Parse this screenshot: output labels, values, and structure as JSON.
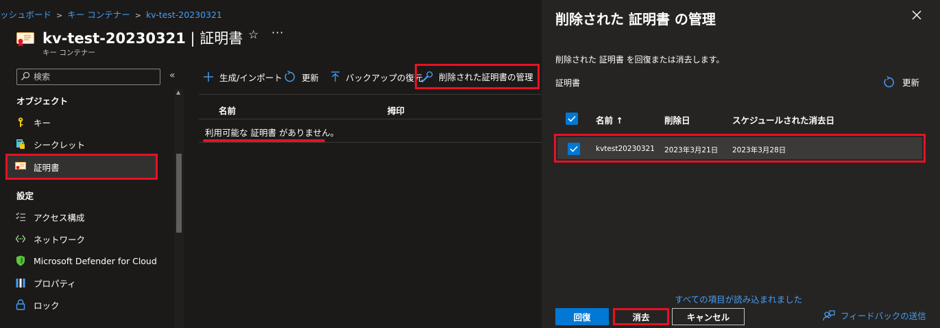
{
  "breadcrumb": {
    "items": [
      "ッシュボード",
      "キー コンテナー",
      "kv-test-20230321"
    ]
  },
  "header": {
    "title": "kv-test-20230321",
    "title_suffix": " | 証明書",
    "subtitle": "キー コンテナー",
    "star_icon": "star-icon",
    "more_label": "···"
  },
  "sidebar": {
    "search_placeholder": "検索",
    "collapse_label": "«",
    "sections": [
      {
        "heading": "オブジェクト",
        "items": [
          {
            "label": "キー",
            "icon": "key-icon"
          },
          {
            "label": "シークレット",
            "icon": "secret-icon"
          },
          {
            "label": "証明書",
            "icon": "certificate-icon",
            "active": true
          }
        ]
      },
      {
        "heading": "設定",
        "items": [
          {
            "label": "アクセス構成",
            "icon": "access-config-icon"
          },
          {
            "label": "ネットワーク",
            "icon": "network-icon"
          },
          {
            "label": "Microsoft Defender for Cloud",
            "icon": "shield-icon"
          },
          {
            "label": "プロパティ",
            "icon": "properties-icon"
          },
          {
            "label": "ロック",
            "icon": "lock-icon"
          }
        ]
      }
    ]
  },
  "toolbar": {
    "generate_import": "生成/インポート",
    "refresh": "更新",
    "backup_restore": "バックアップの復元",
    "manage_deleted": "削除された証明書の管理"
  },
  "table": {
    "columns": [
      "名前",
      "拇印"
    ],
    "empty_message": "利用可能な 証明書 がありません。"
  },
  "panel": {
    "title": "削除された 証明書 の管理",
    "description": "削除された 証明書 を回復または消去します。",
    "section_label": "証明書",
    "refresh": "更新",
    "columns": [
      "名前 ↑",
      "削除日",
      "スケジュールされた消去日"
    ],
    "rows": [
      {
        "name": "kvtest20230321",
        "deleted": "2023年3月21日",
        "purge_date": "2023年3月28日",
        "checked": true
      }
    ],
    "loaded_message": "すべての項目が読み込まれました",
    "buttons": {
      "restore": "回復",
      "purge": "消去",
      "cancel": "キャンセル"
    },
    "feedback": "フィードバックの送信"
  },
  "colors": {
    "background": "#1b1a19",
    "panel_background": "#252423",
    "accent": "#0078d4",
    "link": "#479ef5",
    "highlight": "#e81123"
  }
}
